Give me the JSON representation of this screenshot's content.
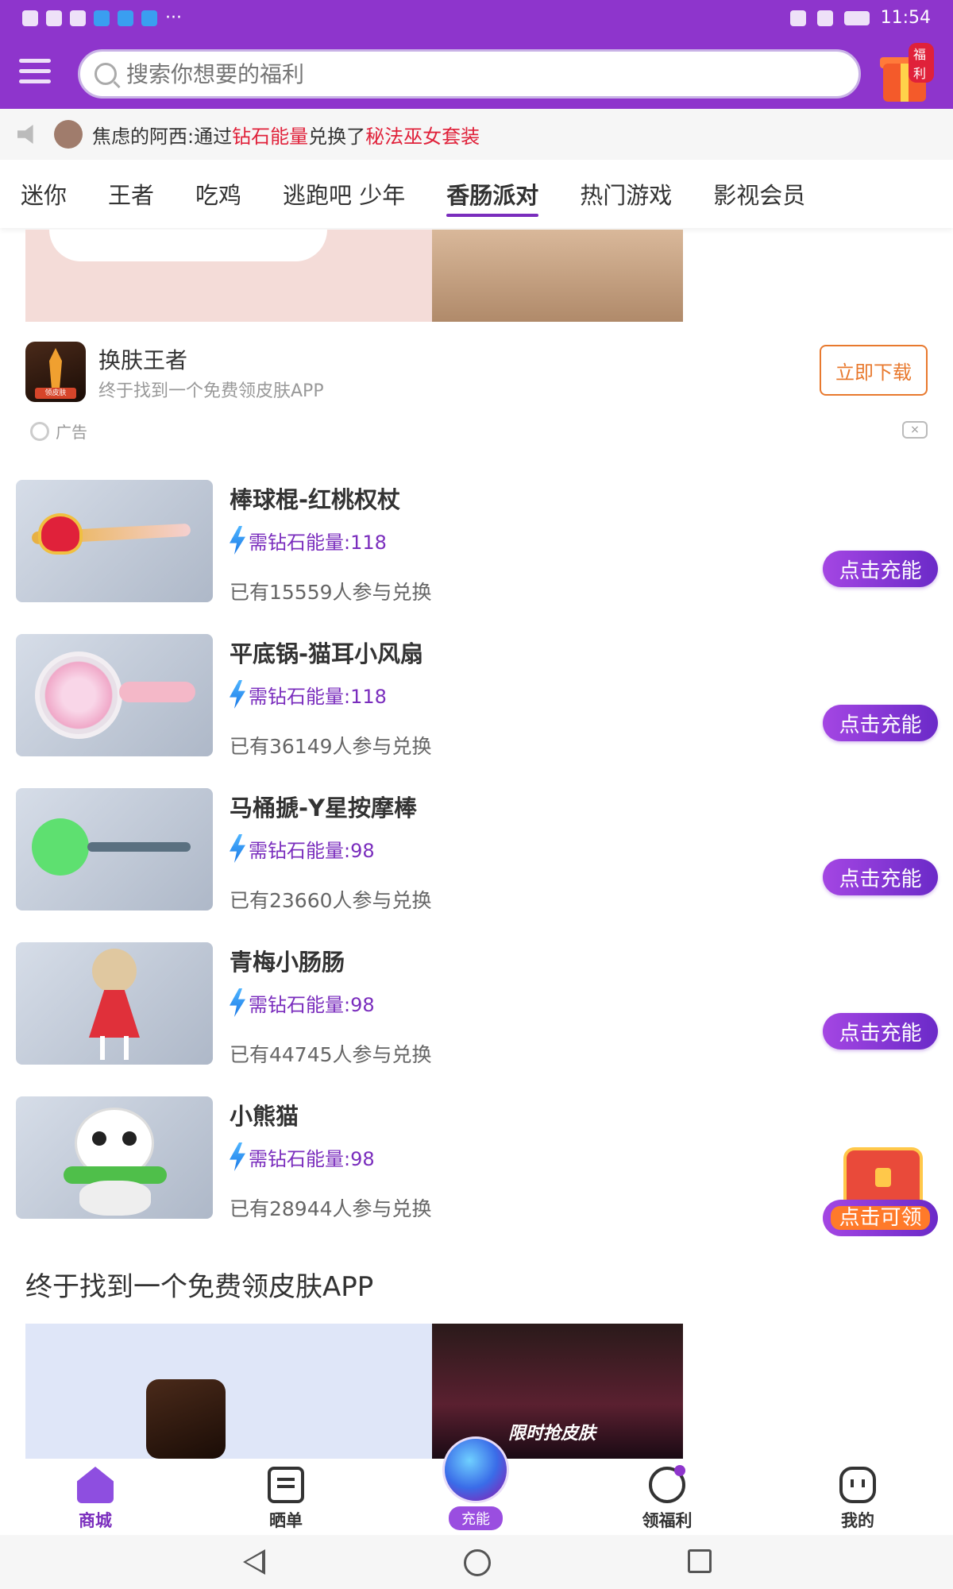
{
  "status": {
    "time": "11:54",
    "more": "···"
  },
  "header": {
    "search_placeholder": "搜索你想要的福利",
    "gift_badge": "福利"
  },
  "notice": {
    "user": "焦虑的阿西:通过",
    "currency": "钻石能量",
    "action": "兑换了",
    "item": "秘法巫女套装"
  },
  "tabs": [
    {
      "label": "迷你",
      "active": false
    },
    {
      "label": "王者",
      "active": false
    },
    {
      "label": "吃鸡",
      "active": false
    },
    {
      "label": "逃跑吧 少年",
      "active": false
    },
    {
      "label": "香肠派对",
      "active": true
    },
    {
      "label": "热门游戏",
      "active": false
    },
    {
      "label": "影视会员",
      "active": false
    }
  ],
  "ad": {
    "app_name": "换肤王者",
    "app_desc": "终于找到一个免费领皮肤APP",
    "download_label": "立即下载",
    "ad_label": "广告",
    "icon_label": "领皮肤"
  },
  "products": [
    {
      "name": "棒球棍-红桃权杖",
      "cost": "需钻石能量:118",
      "joined": "已有15559人参与兑换",
      "action": "点击充能",
      "theme": "scepter"
    },
    {
      "name": "平底锅-猫耳小风扇",
      "cost": "需钻石能量:118",
      "joined": "已有36149人参与兑换",
      "action": "点击充能",
      "theme": "fan"
    },
    {
      "name": "马桶搋-Y星按摩棒",
      "cost": "需钻石能量:98",
      "joined": "已有23660人参与兑换",
      "action": "点击充能",
      "theme": "plunger"
    },
    {
      "name": "青梅小肠肠",
      "cost": "需钻石能量:98",
      "joined": "已有44745人参与兑换",
      "action": "点击充能",
      "theme": "girl"
    },
    {
      "name": "小熊猫",
      "cost": "需钻石能量:98",
      "joined": "已有28944人参与兑换",
      "action": "点击可领",
      "theme": "panda"
    }
  ],
  "section": {
    "title": "终于找到一个免费领皮肤APP",
    "banner_text": "限时抢皮肤"
  },
  "bottom_nav": {
    "home": "商城",
    "post": "晒单",
    "charge": "充能",
    "welfare": "领福利",
    "mine": "我的"
  },
  "colors": {
    "brand": "#8e35cc",
    "accent_red": "#e0213a",
    "download_orange": "#e8792e"
  }
}
